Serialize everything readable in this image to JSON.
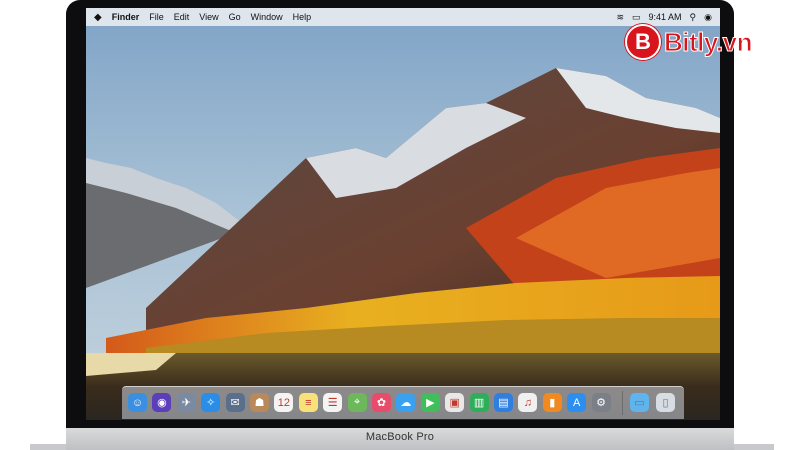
{
  "device": {
    "label": "MacBook Pro"
  },
  "menubar": {
    "apple_icon": "apple-icon",
    "items": [
      "Finder",
      "File",
      "Edit",
      "View",
      "Go",
      "Window",
      "Help"
    ],
    "status": {
      "wifi_icon": "wifi-icon",
      "battery_icon": "battery-icon",
      "clock": "9:41 AM",
      "search_icon": "search-icon",
      "siri_icon": "siri-icon"
    }
  },
  "dock": {
    "apps": [
      {
        "name": "finder-icon",
        "color": "#3b8fe0",
        "glyph": "☺"
      },
      {
        "name": "siri-icon",
        "color": "#5b3fb8",
        "glyph": "◉"
      },
      {
        "name": "launchpad-icon",
        "color": "#7a8aa0",
        "glyph": "✈"
      },
      {
        "name": "safari-icon",
        "color": "#2a8ee8",
        "glyph": "✧"
      },
      {
        "name": "mail-icon",
        "color": "#5a6f8c",
        "glyph": "✉"
      },
      {
        "name": "contacts-icon",
        "color": "#b8895a",
        "glyph": "☗"
      },
      {
        "name": "calendar-icon",
        "color": "#f4f4f4",
        "glyph": "12"
      },
      {
        "name": "notes-icon",
        "color": "#f7e27a",
        "glyph": "≡"
      },
      {
        "name": "reminders-icon",
        "color": "#f4f4f4",
        "glyph": "☰"
      },
      {
        "name": "maps-icon",
        "color": "#6cb85a",
        "glyph": "⌖"
      },
      {
        "name": "photos-icon",
        "color": "#e94b6a",
        "glyph": "✿"
      },
      {
        "name": "messages-icon",
        "color": "#3aa0f0",
        "glyph": "☁"
      },
      {
        "name": "facetime-icon",
        "color": "#3fbf5a",
        "glyph": "▶"
      },
      {
        "name": "photo-booth-icon",
        "color": "#e8e8e8",
        "glyph": "▣"
      },
      {
        "name": "numbers-icon",
        "color": "#2fae5a",
        "glyph": "▥"
      },
      {
        "name": "keynote-icon",
        "color": "#2f7fe0",
        "glyph": "▤"
      },
      {
        "name": "music-icon",
        "color": "#f0f0f0",
        "glyph": "♫"
      },
      {
        "name": "ibooks-icon",
        "color": "#f08a20",
        "glyph": "▮"
      },
      {
        "name": "app-store-icon",
        "color": "#2b8ef0",
        "glyph": "A"
      },
      {
        "name": "system-preferences-icon",
        "color": "#7b7f88",
        "glyph": "⚙"
      }
    ],
    "folders": [
      {
        "name": "downloads-folder-icon",
        "color": "#5fb4ee",
        "glyph": "▭"
      },
      {
        "name": "trash-icon",
        "color": "#d8dde4",
        "glyph": "▯"
      }
    ]
  },
  "watermark": {
    "badge": "B",
    "text": "Bitly.vn"
  }
}
